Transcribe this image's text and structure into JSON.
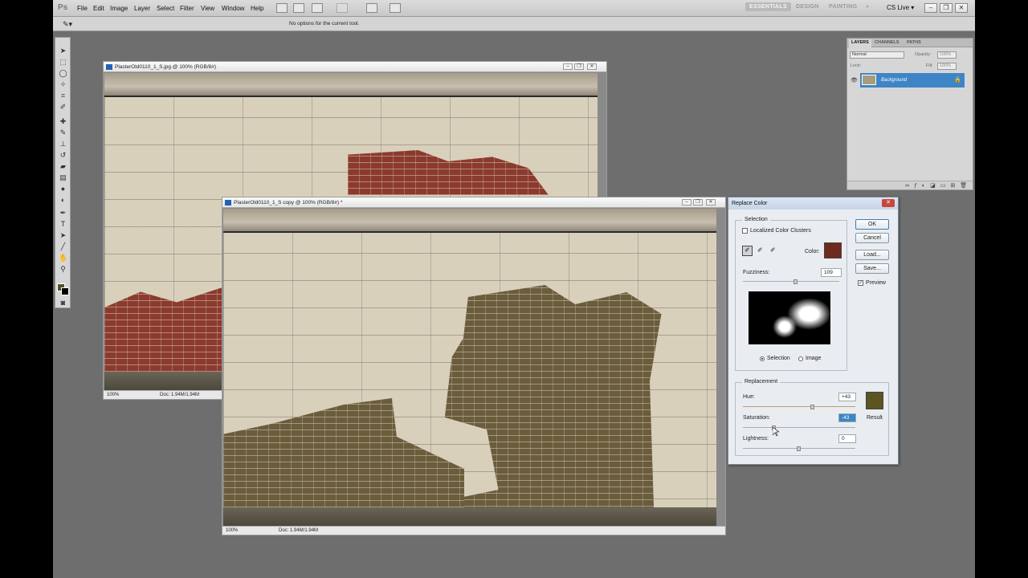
{
  "menubar": {
    "logo": "Ps",
    "items": [
      "File",
      "Edit",
      "Image",
      "Layer",
      "Select",
      "Filter",
      "View",
      "Window",
      "Help"
    ],
    "workspaces": [
      "ESSENTIALS",
      "DESIGN",
      "PAINTING",
      "»"
    ],
    "cs_live": "CS Live ▾"
  },
  "options_bar": {
    "text": "No options for the current tool."
  },
  "doc1": {
    "title": "PlasterOld0110_1_S.jpg @ 100% (RGB/8#)",
    "zoom": "100%",
    "size": "Doc: 1.94M/1.94M"
  },
  "doc2": {
    "title": "PlasterOld0110_1_S copy @ 100% (RGB/8#) *",
    "zoom": "100%",
    "size": "Doc: 1.94M/1.94M"
  },
  "layers_panel": {
    "tabs": [
      "LAYERS",
      "CHANNELS",
      "PATHS"
    ],
    "blend_mode": "Normal",
    "opacity_label": "Opacity:",
    "opacity_value": "100%",
    "fill_label": "Fill:",
    "fill_value": "100%",
    "lock_label": "Lock:",
    "layer_name": "Background"
  },
  "dialog": {
    "title": "Replace Color",
    "selection_label": "Selection",
    "localized_label": "Localized Color Clusters",
    "color_label": "Color:",
    "selection_color": "#6e2a1e",
    "fuzziness_label": "Fuzziness:",
    "fuzziness_value": "109",
    "fuzziness_pos": 0.55,
    "radio_selection": "Selection",
    "radio_image": "Image",
    "replacement_label": "Replacement",
    "hue_label": "Hue:",
    "hue_value": "+43",
    "hue_pos": 0.62,
    "saturation_label": "Saturation:",
    "saturation_value": "-43",
    "saturation_pos": 0.28,
    "lightness_label": "Lightness:",
    "lightness_value": "0",
    "lightness_pos": 0.5,
    "result_label": "Result",
    "result_color": "#5b5520",
    "ok_label": "OK",
    "cancel_label": "Cancel",
    "load_label": "Load...",
    "save_label": "Save...",
    "preview_label": "Preview"
  }
}
